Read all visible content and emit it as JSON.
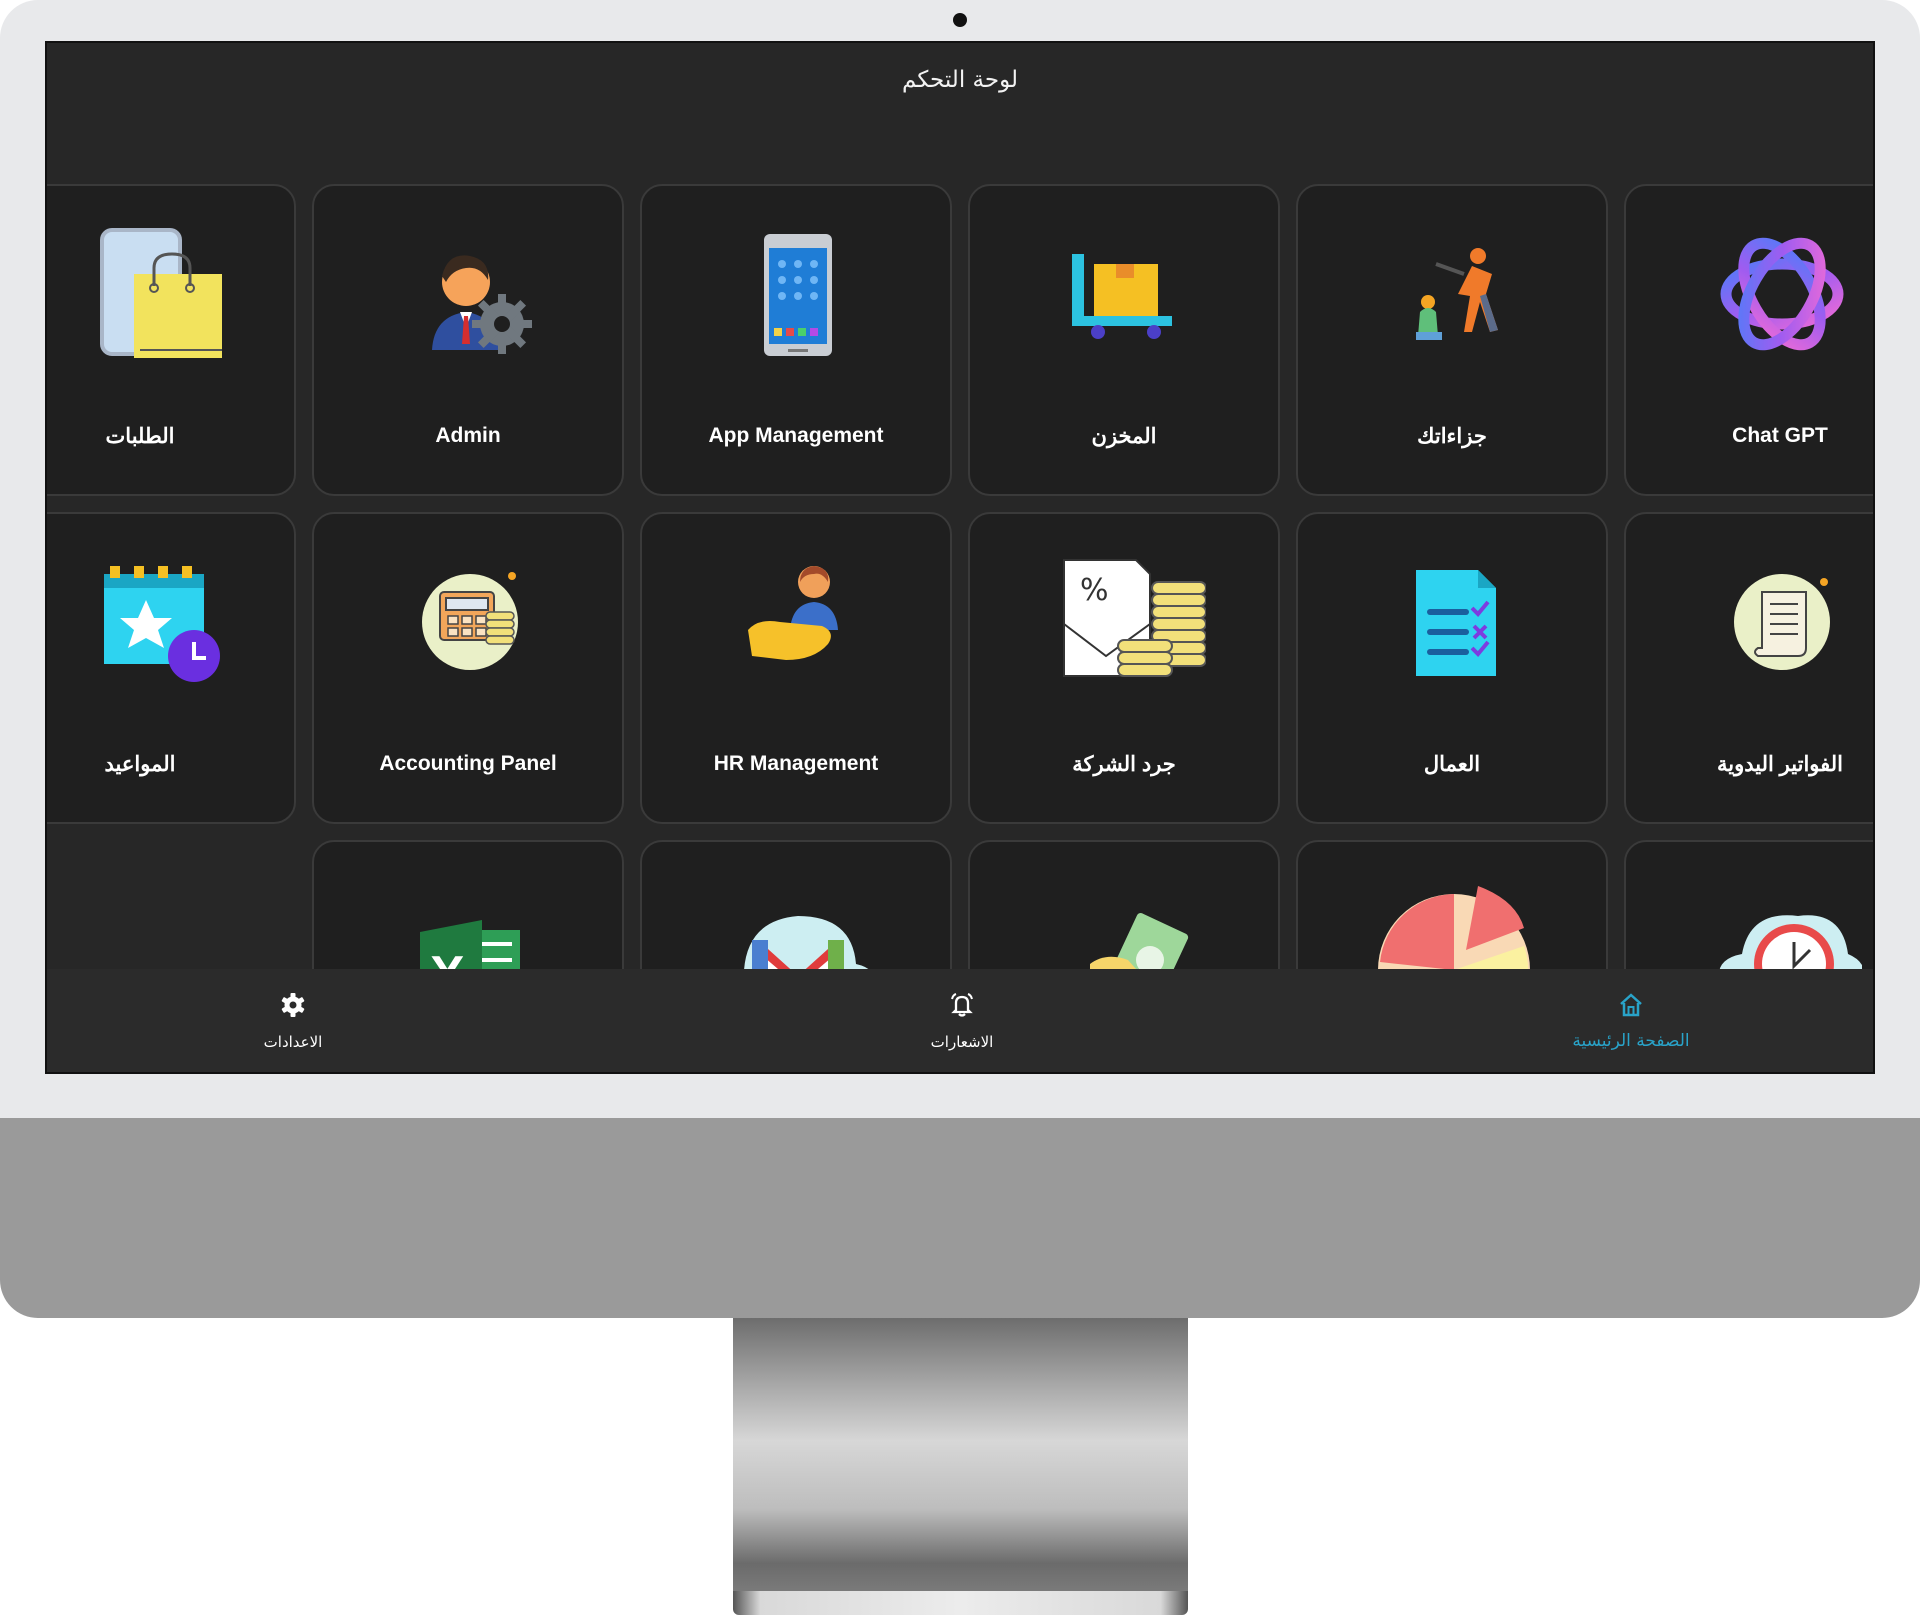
{
  "header": {
    "title": "لوحة التحكم"
  },
  "colors": {
    "screen_bg": "#272727",
    "tile_bg": "#1f1f1f",
    "active_nav": "#29a3c9"
  },
  "tiles": [
    {
      "label": "Chat GPT",
      "icon": "chatgpt-icon"
    },
    {
      "label": "جزاءاتك",
      "icon": "penalty-icon"
    },
    {
      "label": "المخزن",
      "icon": "warehouse-cart-icon"
    },
    {
      "label": "App Management",
      "icon": "smartphone-icon"
    },
    {
      "label": "Admin",
      "icon": "admin-gear-icon"
    },
    {
      "label": "الطلبات",
      "icon": "shopping-bag-icon"
    },
    {
      "label": "الفواتير اليدوية",
      "icon": "receipt-icon"
    },
    {
      "label": "العمال",
      "icon": "checklist-icon"
    },
    {
      "label": "جرد الشركة",
      "icon": "coins-envelope-icon"
    },
    {
      "label": "HR Management",
      "icon": "hr-hand-icon"
    },
    {
      "label": "Accounting Panel",
      "icon": "calculator-coins-icon"
    },
    {
      "label": "المواعيد",
      "icon": "calendar-clock-icon"
    },
    {
      "label": "",
      "icon": "clock-cloud-icon"
    },
    {
      "label": "",
      "icon": "pie-chart-icon"
    },
    {
      "label": "",
      "icon": "money-hand-icon"
    },
    {
      "label": "",
      "icon": "gmail-cloud-icon"
    },
    {
      "label": "",
      "icon": "excel-icon"
    }
  ],
  "bottom_nav": {
    "home": {
      "label": "الصفحة الرئيسية",
      "icon": "home-icon"
    },
    "notifications": {
      "label": "الاشعارات",
      "icon": "bell-icon"
    },
    "settings": {
      "label": "الاعدادات",
      "icon": "gear-icon"
    }
  }
}
